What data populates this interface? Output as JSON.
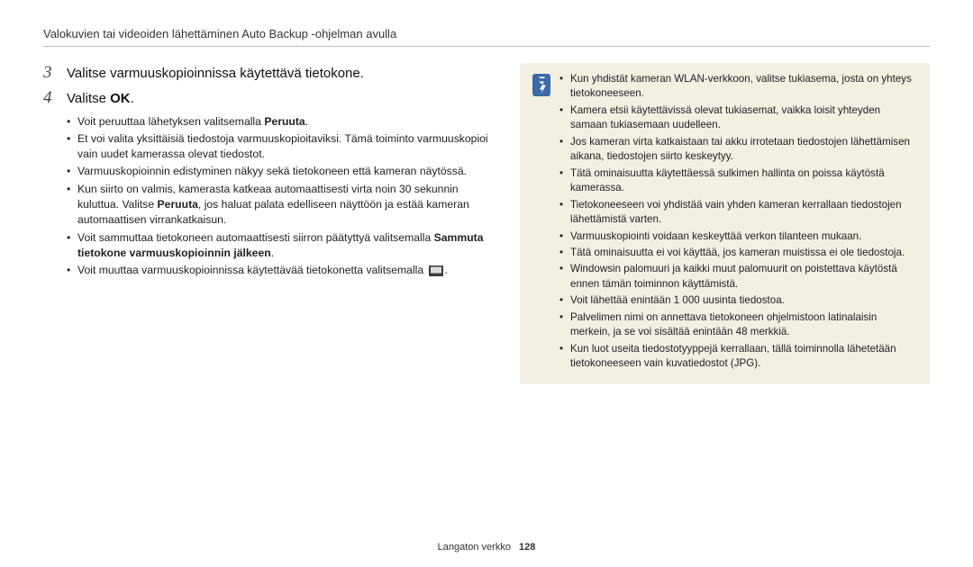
{
  "header": {
    "title": "Valokuvien tai videoiden lähettäminen Auto Backup -ohjelman avulla"
  },
  "steps": {
    "s3": {
      "num": "3",
      "text": "Valitse varmuuskopioinnissa käytettävä tietokone."
    },
    "s4": {
      "num": "4",
      "prefix": "Valitse ",
      "bold": "OK",
      "suffix": "."
    }
  },
  "sub": {
    "b1_pre": "Voit peruuttaa lähetyksen valitsemalla ",
    "b1_bold": "Peruuta",
    "b1_post": ".",
    "b2": "Et voi valita yksittäisiä tiedostoja varmuuskopioitaviksi. Tämä toiminto varmuuskopioi vain uudet kamerassa olevat tiedostot.",
    "b3": "Varmuuskopioinnin edistyminen näkyy sekä tietokoneen että kameran näytössä.",
    "b4_pre": "Kun siirto on valmis, kamerasta katkeaa automaattisesti virta noin 30 sekunnin kuluttua. Valitse ",
    "b4_bold": "Peruuta",
    "b4_post": ", jos haluat palata edelliseen näyttöön ja estää kameran automaattisen virrankatkaisun.",
    "b5_pre": "Voit sammuttaa tietokoneen automaattisesti siirron päätyttyä valitsemalla ",
    "b5_bold": "Sammuta tietokone varmuuskopioinnin jälkeen",
    "b5_post": ".",
    "b6_pre": "Voit muuttaa varmuuskopioinnissa käytettävää tietokonetta valitsemalla ",
    "b6_post": "."
  },
  "notes": {
    "n1": "Kun yhdistät kameran WLAN-verkkoon, valitse tukiasema, josta on yhteys tietokoneeseen.",
    "n2": "Kamera etsii käytettävissä olevat tukiasemat, vaikka loisit yhteyden samaan tukiasemaan uudelleen.",
    "n3": "Jos kameran virta katkaistaan tai akku irrotetaan tiedostojen lähettämisen aikana, tiedostojen siirto keskeytyy.",
    "n4": "Tätä ominaisuutta käytettäessä sulkimen hallinta on poissa käytöstä kamerassa.",
    "n5": "Tietokoneeseen voi yhdistää vain yhden kameran kerrallaan tiedostojen lähettämistä varten.",
    "n6": "Varmuuskopiointi voidaan keskeyttää verkon tilanteen mukaan.",
    "n7": "Tätä ominaisuutta ei voi käyttää, jos kameran muistissa ei ole tiedostoja.",
    "n8": "Windowsin palomuuri ja kaikki muut palomuurit on poistettava käytöstä ennen tämän toiminnon käyttämistä.",
    "n9": "Voit lähettää enintään 1 000 uusinta tiedostoa.",
    "n10": "Palvelimen nimi on annettava tietokoneen ohjelmistoon latinalaisin merkein, ja se voi sisältää enintään 48 merkkiä.",
    "n11": "Kun luot useita tiedostotyyppejä kerrallaan, tällä toiminnolla lähetetään tietokoneeseen vain kuvatiedostot (JPG)."
  },
  "footer": {
    "section": "Langaton verkko",
    "page": "128"
  }
}
